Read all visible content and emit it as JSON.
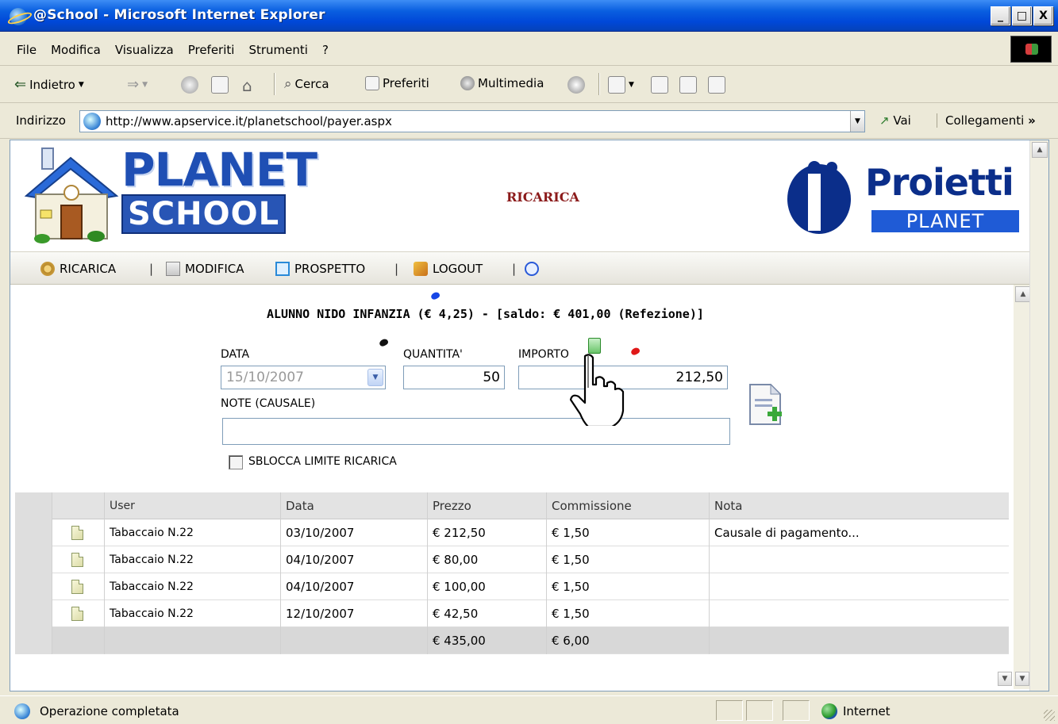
{
  "window": {
    "title": "@School - Microsoft Internet Explorer",
    "controls": [
      "_",
      "□",
      "X"
    ]
  },
  "menubar": {
    "items": [
      "File",
      "Modifica",
      "Visualizza",
      "Preferiti",
      "Strumenti",
      "?"
    ]
  },
  "toolbar": {
    "back_label": "Indietro",
    "search_label": "Cerca",
    "favorites_label": "Preferiti",
    "media_label": "Multimedia"
  },
  "address": {
    "label": "Indirizzo",
    "url": "http://www.apservice.it/planetschool/payer.aspx",
    "go_label": "Vai",
    "links_label": "Collegamenti",
    "links_more": "»"
  },
  "header": {
    "logo_top": "PLANET",
    "logo_bottom": "SCHOOL",
    "page_title": "RICARICA",
    "brand_word": "Proietti",
    "brand_bar": "PLANET"
  },
  "nav": {
    "ricarica": "RICARICA",
    "modifica": "MODIFICA",
    "prospetto": "PROSPETTO",
    "logout": "LOGOUT",
    "separator": "|"
  },
  "form": {
    "student_line": "ALUNNO NIDO INFANZIA (€ 4,25) - [saldo: € 401,00 (Refezione)]",
    "data_label": "DATA",
    "data_value": "15/10/2007",
    "quantita_label": "QUANTITA'",
    "quantita_value": "50",
    "importo_label": "IMPORTO",
    "importo_value": "212,50",
    "note_label": "NOTE (CAUSALE)",
    "note_value": "",
    "sblocca_label": "SBLOCCA LIMITE RICARICA",
    "sblocca_checked": false
  },
  "grid": {
    "headers": [
      "",
      "",
      "User",
      "Data",
      "Prezzo",
      "Commissione",
      "Nota"
    ],
    "rows": [
      {
        "user": "Tabaccaio N.22",
        "data": "03/10/2007",
        "prezzo": "€ 212,50",
        "commissione": "€ 1,50",
        "nota": "Causale di pagamento..."
      },
      {
        "user": "Tabaccaio N.22",
        "data": "04/10/2007",
        "prezzo": "€ 80,00",
        "commissione": "€ 1,50",
        "nota": ""
      },
      {
        "user": "Tabaccaio N.22",
        "data": "04/10/2007",
        "prezzo": "€ 100,00",
        "commissione": "€ 1,50",
        "nota": ""
      },
      {
        "user": "Tabaccaio N.22",
        "data": "12/10/2007",
        "prezzo": "€ 42,50",
        "commissione": "€ 1,50",
        "nota": ""
      }
    ],
    "totals": {
      "prezzo": "€ 435,00",
      "commissione": "€ 6,00"
    }
  },
  "status": {
    "message": "Operazione completata",
    "zone": "Internet"
  },
  "colors": {
    "title_gradient": "#0a5fe0",
    "page_title": "#8b1a1a",
    "brand_blue": "#1f4fb4",
    "dot_blue": "#1646e6",
    "dot_black": "#111111",
    "dot_red": "#e01818"
  }
}
